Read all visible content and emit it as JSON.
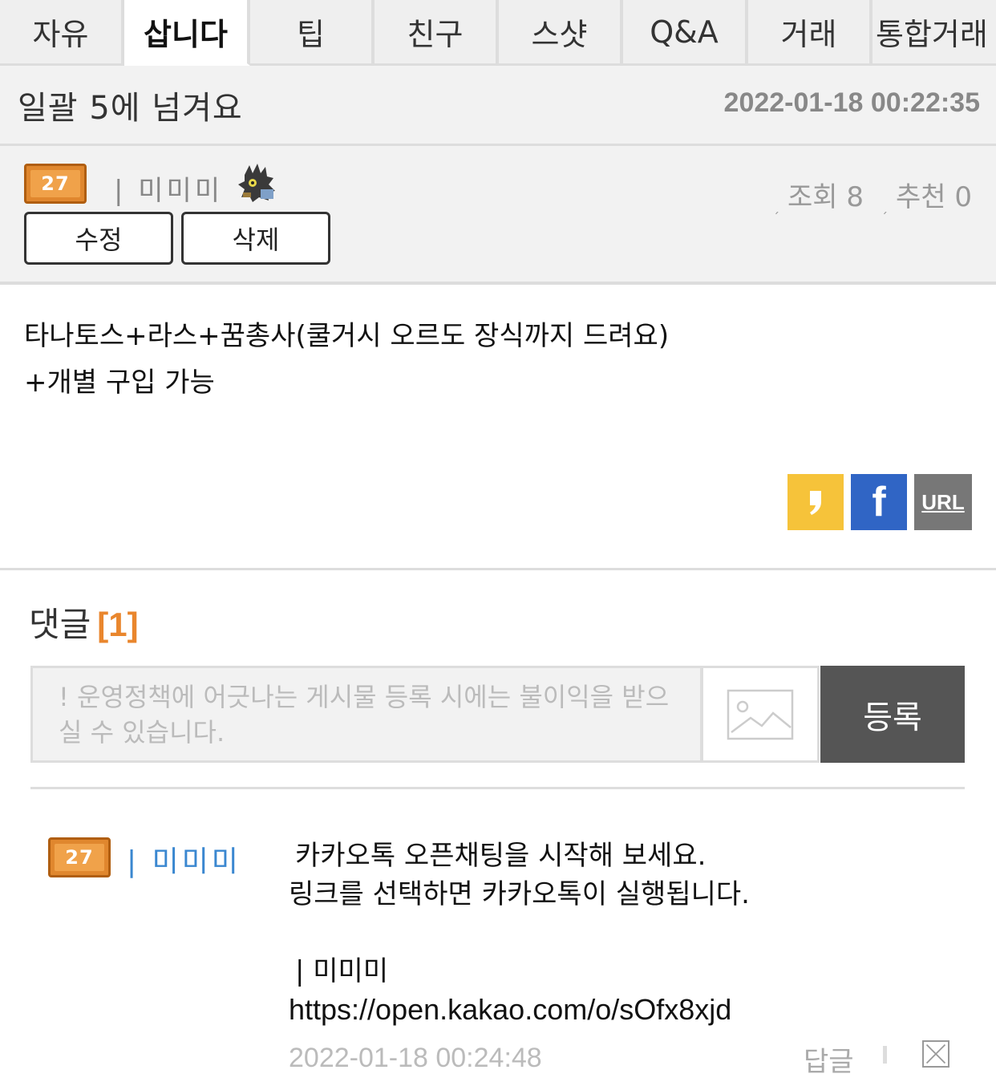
{
  "tabs": [
    {
      "label": "자유",
      "active": false
    },
    {
      "label": "삽니다",
      "active": true
    },
    {
      "label": "팁",
      "active": false
    },
    {
      "label": "친구",
      "active": false
    },
    {
      "label": "스샷",
      "active": false
    },
    {
      "label": "Q&A",
      "active": false
    },
    {
      "label": "거래",
      "active": false
    },
    {
      "label": "통합거래",
      "active": false
    }
  ],
  "post": {
    "title": "일괄 5에 넘겨요",
    "date": "2022-01-18 00:22:35",
    "author": {
      "level_badge": "27",
      "name": "| 미미미",
      "avatar_icon": "character-avatar-icon"
    },
    "stats": {
      "views_label": "조회 8",
      "recommend_label": "추천 0"
    },
    "buttons": {
      "edit": "수정",
      "delete": "삭제"
    },
    "body_lines": [
      "타나토스+라스+꿈총사(쿨거시 오르도 장식까지 드려요)",
      "+개별 구입 가능"
    ],
    "share": {
      "kakao_icon": "kakao-share-icon",
      "facebook_glyph": "f",
      "url_label": "URL",
      "colors": {
        "kakao": "#f6c33a",
        "facebook": "#3065c5",
        "url": "#777777"
      }
    }
  },
  "comments": {
    "heading": "댓글",
    "count": "[1]",
    "input_placeholder": "! 운영정책에 어긋나는 게시물 등록 시에는 불이익을 받으실 수 있습니다.",
    "image_icon": "image-upload-icon",
    "submit_label": "등록",
    "items": [
      {
        "level_badge": "27",
        "author": "| 미미미",
        "lines": [
          "카카오톡 오픈채팅을 시작해 보세요.",
          "링크를 선택하면 카카오톡이 실행됩니다.",
          "",
          "| 미미미",
          "https://open.kakao.com/o/sOfx8xjd"
        ],
        "date": "2022-01-18 00:24:48",
        "reply_label": "답글",
        "delete_icon": "close-box-icon"
      }
    ]
  },
  "colors": {
    "accent_orange": "#e9862d",
    "author_blue": "#3a87d0",
    "header_bg": "#f2f2f2"
  }
}
